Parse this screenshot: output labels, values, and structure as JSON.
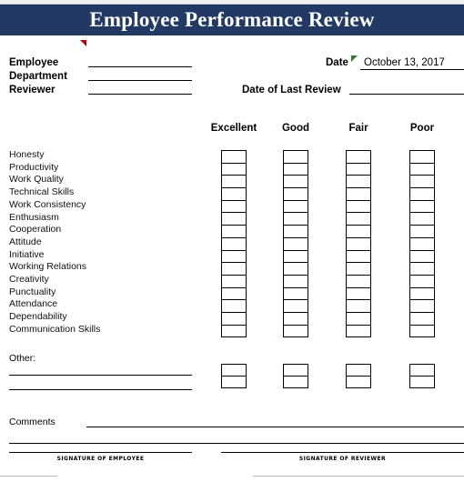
{
  "document": {
    "title": "Employee Performance Review",
    "banner_color": "#223a63",
    "banner_text_color": "#ffffff"
  },
  "header_fields": {
    "employee_label": "Employee",
    "department_label": "Department",
    "reviewer_label": "Reviewer",
    "employee_value": "",
    "department_value": "",
    "reviewer_value": "",
    "date_label": "Date",
    "date_value": "October 13, 2017",
    "last_review_label": "Date of Last Review",
    "last_review_value": ""
  },
  "markers": {
    "employee_comment_color": "#c00000",
    "date_comment_color": "#2e7d32"
  },
  "rating_columns": [
    {
      "label": "Excellent"
    },
    {
      "label": "Good"
    },
    {
      "label": "Fair"
    },
    {
      "label": "Poor"
    }
  ],
  "criteria": [
    "Honesty",
    "Productivity",
    "Work Quality",
    "Technical Skills",
    "Work Consistency",
    "Enthusiasm",
    "Cooperation",
    "Attitude",
    "Initiative",
    "Working Relations",
    "Creativity",
    "Punctuality",
    "Attendance",
    "Dependability",
    "Communication Skills"
  ],
  "other_section": {
    "label": "Other:",
    "line_count": 2,
    "box_rows": 2
  },
  "comments_section": {
    "label": "Comments",
    "value": "",
    "line_count": 2
  },
  "signatures": {
    "employee_caption": "SIGNATURE OF EMPLOYEE",
    "reviewer_caption": "SIGNATURE OF REVIEWER"
  }
}
